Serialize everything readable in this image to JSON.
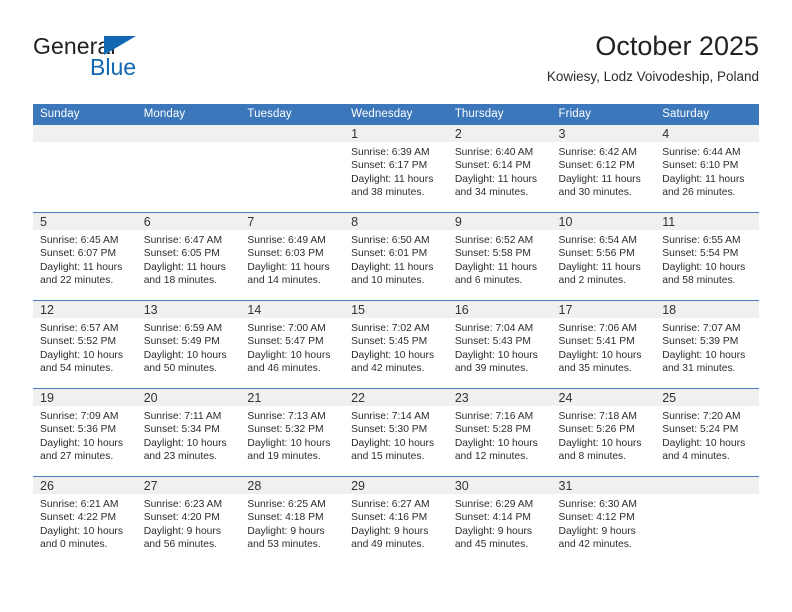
{
  "brand": {
    "word_general": "General",
    "word_blue": "Blue",
    "triangle_color": "#1267b2"
  },
  "header": {
    "title": "October 2025",
    "subtitle": "Kowiesy, Lodz Voivodeship, Poland"
  },
  "theme": {
    "header_blue": "#3b77ba",
    "daynum_gray": "#f0f0f0",
    "grid_line": "#4a7fba"
  },
  "labels": {
    "sunrise_prefix": "Sunrise:",
    "sunset_prefix": "Sunset:",
    "daylight_prefix": "Daylight:"
  },
  "weekday_headers": [
    "Sunday",
    "Monday",
    "Tuesday",
    "Wednesday",
    "Thursday",
    "Friday",
    "Saturday"
  ],
  "weeks": [
    [
      {
        "day": "",
        "sunrise": "",
        "sunset": "",
        "daylight": ""
      },
      {
        "day": "",
        "sunrise": "",
        "sunset": "",
        "daylight": ""
      },
      {
        "day": "",
        "sunrise": "",
        "sunset": "",
        "daylight": ""
      },
      {
        "day": "1",
        "sunrise": "Sunrise: 6:39 AM",
        "sunset": "Sunset: 6:17 PM",
        "daylight": "Daylight: 11 hours and 38 minutes."
      },
      {
        "day": "2",
        "sunrise": "Sunrise: 6:40 AM",
        "sunset": "Sunset: 6:14 PM",
        "daylight": "Daylight: 11 hours and 34 minutes."
      },
      {
        "day": "3",
        "sunrise": "Sunrise: 6:42 AM",
        "sunset": "Sunset: 6:12 PM",
        "daylight": "Daylight: 11 hours and 30 minutes."
      },
      {
        "day": "4",
        "sunrise": "Sunrise: 6:44 AM",
        "sunset": "Sunset: 6:10 PM",
        "daylight": "Daylight: 11 hours and 26 minutes."
      }
    ],
    [
      {
        "day": "5",
        "sunrise": "Sunrise: 6:45 AM",
        "sunset": "Sunset: 6:07 PM",
        "daylight": "Daylight: 11 hours and 22 minutes."
      },
      {
        "day": "6",
        "sunrise": "Sunrise: 6:47 AM",
        "sunset": "Sunset: 6:05 PM",
        "daylight": "Daylight: 11 hours and 18 minutes."
      },
      {
        "day": "7",
        "sunrise": "Sunrise: 6:49 AM",
        "sunset": "Sunset: 6:03 PM",
        "daylight": "Daylight: 11 hours and 14 minutes."
      },
      {
        "day": "8",
        "sunrise": "Sunrise: 6:50 AM",
        "sunset": "Sunset: 6:01 PM",
        "daylight": "Daylight: 11 hours and 10 minutes."
      },
      {
        "day": "9",
        "sunrise": "Sunrise: 6:52 AM",
        "sunset": "Sunset: 5:58 PM",
        "daylight": "Daylight: 11 hours and 6 minutes."
      },
      {
        "day": "10",
        "sunrise": "Sunrise: 6:54 AM",
        "sunset": "Sunset: 5:56 PM",
        "daylight": "Daylight: 11 hours and 2 minutes."
      },
      {
        "day": "11",
        "sunrise": "Sunrise: 6:55 AM",
        "sunset": "Sunset: 5:54 PM",
        "daylight": "Daylight: 10 hours and 58 minutes."
      }
    ],
    [
      {
        "day": "12",
        "sunrise": "Sunrise: 6:57 AM",
        "sunset": "Sunset: 5:52 PM",
        "daylight": "Daylight: 10 hours and 54 minutes."
      },
      {
        "day": "13",
        "sunrise": "Sunrise: 6:59 AM",
        "sunset": "Sunset: 5:49 PM",
        "daylight": "Daylight: 10 hours and 50 minutes."
      },
      {
        "day": "14",
        "sunrise": "Sunrise: 7:00 AM",
        "sunset": "Sunset: 5:47 PM",
        "daylight": "Daylight: 10 hours and 46 minutes."
      },
      {
        "day": "15",
        "sunrise": "Sunrise: 7:02 AM",
        "sunset": "Sunset: 5:45 PM",
        "daylight": "Daylight: 10 hours and 42 minutes."
      },
      {
        "day": "16",
        "sunrise": "Sunrise: 7:04 AM",
        "sunset": "Sunset: 5:43 PM",
        "daylight": "Daylight: 10 hours and 39 minutes."
      },
      {
        "day": "17",
        "sunrise": "Sunrise: 7:06 AM",
        "sunset": "Sunset: 5:41 PM",
        "daylight": "Daylight: 10 hours and 35 minutes."
      },
      {
        "day": "18",
        "sunrise": "Sunrise: 7:07 AM",
        "sunset": "Sunset: 5:39 PM",
        "daylight": "Daylight: 10 hours and 31 minutes."
      }
    ],
    [
      {
        "day": "19",
        "sunrise": "Sunrise: 7:09 AM",
        "sunset": "Sunset: 5:36 PM",
        "daylight": "Daylight: 10 hours and 27 minutes."
      },
      {
        "day": "20",
        "sunrise": "Sunrise: 7:11 AM",
        "sunset": "Sunset: 5:34 PM",
        "daylight": "Daylight: 10 hours and 23 minutes."
      },
      {
        "day": "21",
        "sunrise": "Sunrise: 7:13 AM",
        "sunset": "Sunset: 5:32 PM",
        "daylight": "Daylight: 10 hours and 19 minutes."
      },
      {
        "day": "22",
        "sunrise": "Sunrise: 7:14 AM",
        "sunset": "Sunset: 5:30 PM",
        "daylight": "Daylight: 10 hours and 15 minutes."
      },
      {
        "day": "23",
        "sunrise": "Sunrise: 7:16 AM",
        "sunset": "Sunset: 5:28 PM",
        "daylight": "Daylight: 10 hours and 12 minutes."
      },
      {
        "day": "24",
        "sunrise": "Sunrise: 7:18 AM",
        "sunset": "Sunset: 5:26 PM",
        "daylight": "Daylight: 10 hours and 8 minutes."
      },
      {
        "day": "25",
        "sunrise": "Sunrise: 7:20 AM",
        "sunset": "Sunset: 5:24 PM",
        "daylight": "Daylight: 10 hours and 4 minutes."
      }
    ],
    [
      {
        "day": "26",
        "sunrise": "Sunrise: 6:21 AM",
        "sunset": "Sunset: 4:22 PM",
        "daylight": "Daylight: 10 hours and 0 minutes."
      },
      {
        "day": "27",
        "sunrise": "Sunrise: 6:23 AM",
        "sunset": "Sunset: 4:20 PM",
        "daylight": "Daylight: 9 hours and 56 minutes."
      },
      {
        "day": "28",
        "sunrise": "Sunrise: 6:25 AM",
        "sunset": "Sunset: 4:18 PM",
        "daylight": "Daylight: 9 hours and 53 minutes."
      },
      {
        "day": "29",
        "sunrise": "Sunrise: 6:27 AM",
        "sunset": "Sunset: 4:16 PM",
        "daylight": "Daylight: 9 hours and 49 minutes."
      },
      {
        "day": "30",
        "sunrise": "Sunrise: 6:29 AM",
        "sunset": "Sunset: 4:14 PM",
        "daylight": "Daylight: 9 hours and 45 minutes."
      },
      {
        "day": "31",
        "sunrise": "Sunrise: 6:30 AM",
        "sunset": "Sunset: 4:12 PM",
        "daylight": "Daylight: 9 hours and 42 minutes."
      },
      {
        "day": "",
        "sunrise": "",
        "sunset": "",
        "daylight": ""
      }
    ]
  ]
}
